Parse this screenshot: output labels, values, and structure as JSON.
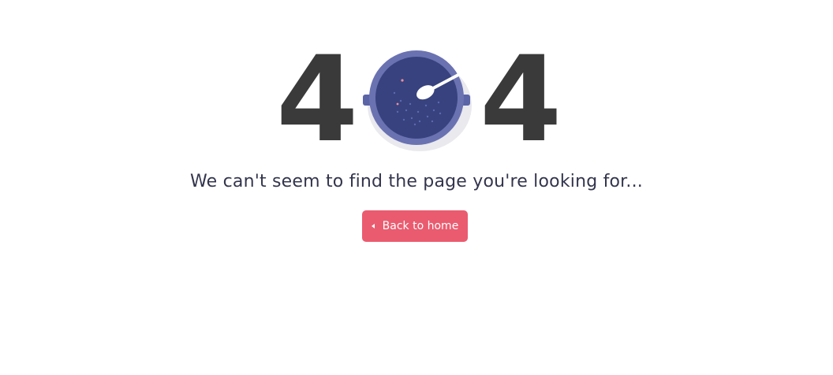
{
  "error": {
    "digit_left": "4",
    "digit_right": "4",
    "zero_icon": "soup-bowl-with-spoon-icon"
  },
  "message": "We can't seem to find the page you're looking for...",
  "back_button": {
    "label": "Back to home",
    "icon": "chevron-left-icon"
  },
  "colors": {
    "digit": "#3a3a3a",
    "bowl_outer": "#6a72b2",
    "bowl_inner": "#37427e",
    "button": "#ea5b6f",
    "message": "#33354d"
  }
}
